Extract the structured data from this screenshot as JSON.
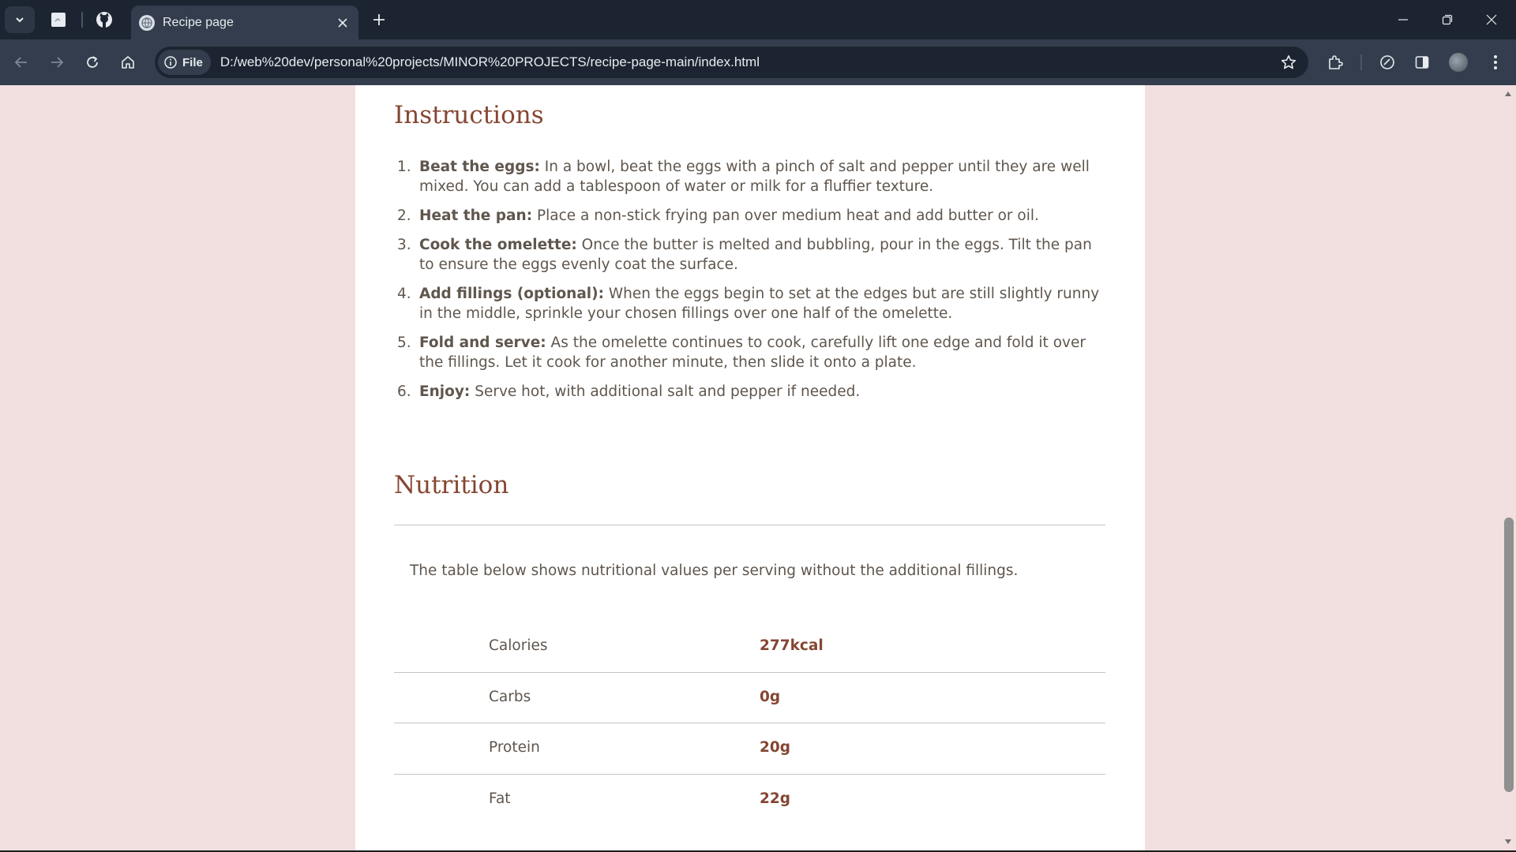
{
  "browser": {
    "tab_title": "Recipe page",
    "site_chip_label": "File",
    "url": "D:/web%20dev/personal%20projects/MINOR%20PROJECTS/recipe-page-main/index.html",
    "icons": {
      "tab_list": "chevron-down-icon",
      "pinned_1": "app-icon",
      "pinned_2": "github-icon",
      "new_tab": "plus-icon",
      "back": "arrow-left-icon",
      "forward": "arrow-right-icon",
      "reload": "reload-icon",
      "home": "home-icon",
      "info": "info-icon",
      "bookmark": "star-icon",
      "extensions": "puzzle-icon",
      "performance": "gauge-icon",
      "side_panel": "side-panel-icon",
      "profile": "avatar",
      "menu": "kebab-menu-icon"
    },
    "colors": {
      "tabbar": "#1c2431",
      "toolbar": "#333d4d"
    }
  },
  "page": {
    "colors": {
      "background": "#f2dfe0",
      "card": "#ffffff",
      "heading": "#854632",
      "text": "#5f564d"
    },
    "instructions": {
      "heading": "Instructions",
      "steps": [
        {
          "num": "1.",
          "title": "Beat the eggs:",
          "text": " In a bowl, beat the eggs with a pinch of salt and pepper until they are well mixed. You can add a tablespoon of water or milk for a fluffier texture."
        },
        {
          "num": "2.",
          "title": "Heat the pan:",
          "text": " Place a non-stick frying pan over medium heat and add butter or oil."
        },
        {
          "num": "3.",
          "title": "Cook the omelette:",
          "text": " Once the butter is melted and bubbling, pour in the eggs. Tilt the pan to ensure the eggs evenly coat the surface."
        },
        {
          "num": "4.",
          "title": "Add fillings (optional):",
          "text": " When the eggs begin to set at the edges but are still slightly runny in the middle, sprinkle your chosen fillings over one half of the omelette."
        },
        {
          "num": "5.",
          "title": "Fold and serve:",
          "text": " As the omelette continues to cook, carefully lift one edge and fold it over the fillings. Let it cook for another minute, then slide it onto a plate."
        },
        {
          "num": "6.",
          "title": "Enjoy:",
          "text": " Serve hot, with additional salt and pepper if needed."
        }
      ]
    },
    "nutrition": {
      "heading": "Nutrition",
      "intro": "The table below shows nutritional values per serving without the additional fillings.",
      "rows": [
        {
          "label": "Calories",
          "value": "277kcal"
        },
        {
          "label": "Carbs",
          "value": "0g"
        },
        {
          "label": "Protein",
          "value": "20g"
        },
        {
          "label": "Fat",
          "value": "22g"
        }
      ]
    }
  }
}
